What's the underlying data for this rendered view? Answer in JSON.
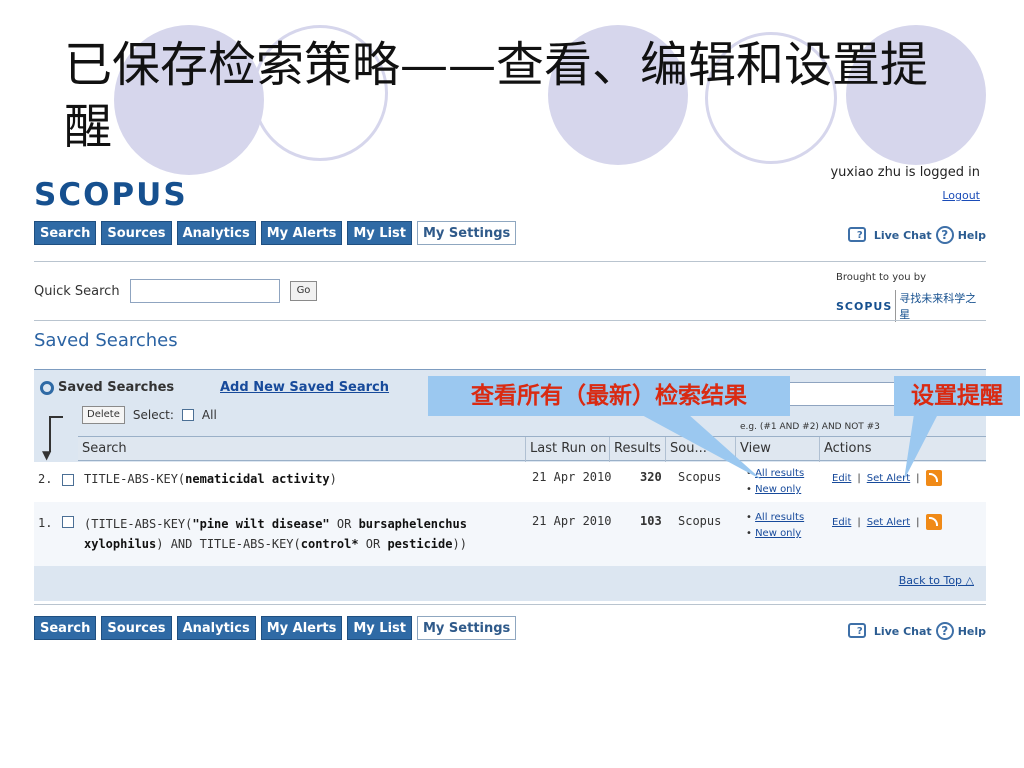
{
  "slide": {
    "title": "已保存检索策略——查看、编辑和设置提醒"
  },
  "header": {
    "logo_text": "SCOPUS",
    "logged_in_text": "yuxiao zhu is logged in",
    "logout": "Logout"
  },
  "nav": {
    "items": [
      "Search",
      "Sources",
      "Analytics",
      "My Alerts",
      "My List",
      "My Settings"
    ]
  },
  "help": {
    "live_chat": "Live Chat",
    "help": "Help"
  },
  "quick_search": {
    "label": "Quick Search",
    "value": "",
    "go": "Go"
  },
  "brought": {
    "text": "Brought to you by",
    "logo": "SCOPUS",
    "slogan": "寻找未来科学之星"
  },
  "saved": {
    "page_title": "Saved Searches",
    "panel_title": "Saved Searches",
    "add_new": "Add New Saved Search",
    "delete": "Delete",
    "select_label": "Select:",
    "all_label": "All",
    "search_example": "e.g. (#1 AND #2) AND NOT #3"
  },
  "table": {
    "headers": [
      "Search",
      "Last Run on",
      "Results",
      "Sou...",
      "View",
      "Actions"
    ],
    "rows": [
      {
        "num": "2.",
        "query_prefix": "TITLE-ABS-KEY(",
        "query_terms": [
          "nematicidal activity"
        ],
        "query_suffix": ")",
        "date": "21 Apr 2010",
        "results": "320",
        "source": "Scopus",
        "view_all": "All results",
        "view_new": "New only",
        "edit": "Edit",
        "set_alert": "Set Alert"
      },
      {
        "num": "1.",
        "line1_a": "(TITLE-ABS-KEY(",
        "line1_b": "\"pine wilt disease\"",
        "line1_c": " OR ",
        "line1_d": "bursaphelenchus",
        "line2_a": "xylophilus",
        "line2_b": ") AND TITLE-ABS-KEY(",
        "line2_c": "control*",
        "line2_d": " OR ",
        "line2_e": "pesticide",
        "line2_f": "))",
        "date": "21 Apr 2010",
        "results": "103",
        "source": "Scopus",
        "view_all": "All results",
        "view_new": "New only",
        "edit": "Edit",
        "set_alert": "Set Alert"
      }
    ],
    "back_to_top": "Back to Top △"
  },
  "callouts": {
    "view_results": "查看所有（最新）检索结果",
    "set_alert": "设置提醒"
  },
  "colors": {
    "nav_blue": "#2f6aa5",
    "callout_blue": "#9bc8f0",
    "callout_text": "#d92a12"
  }
}
